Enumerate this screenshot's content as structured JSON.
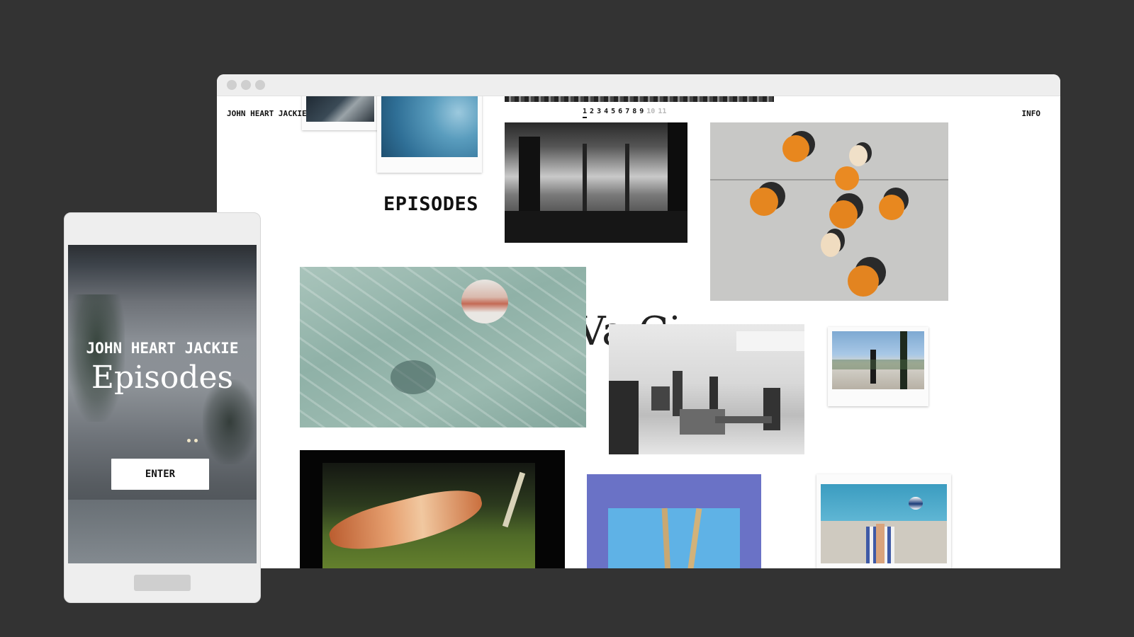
{
  "desktop": {
    "brand": "JOHN HEART JACKIE",
    "info_label": "INFO",
    "pages": [
      "1",
      "2",
      "3",
      "4",
      "5",
      "6",
      "7",
      "8",
      "9",
      "10",
      "11"
    ],
    "current_page": "1",
    "section_title": "EPISODES",
    "background_word": "Va    Ci"
  },
  "mobile": {
    "brand": "JOHN HEART JACKIE",
    "title": "Episodes",
    "enter_label": "ENTER"
  },
  "colors": {
    "background": "#333333",
    "window_chrome": "#eeeeee",
    "page": "#ffffff",
    "text": "#111111"
  }
}
